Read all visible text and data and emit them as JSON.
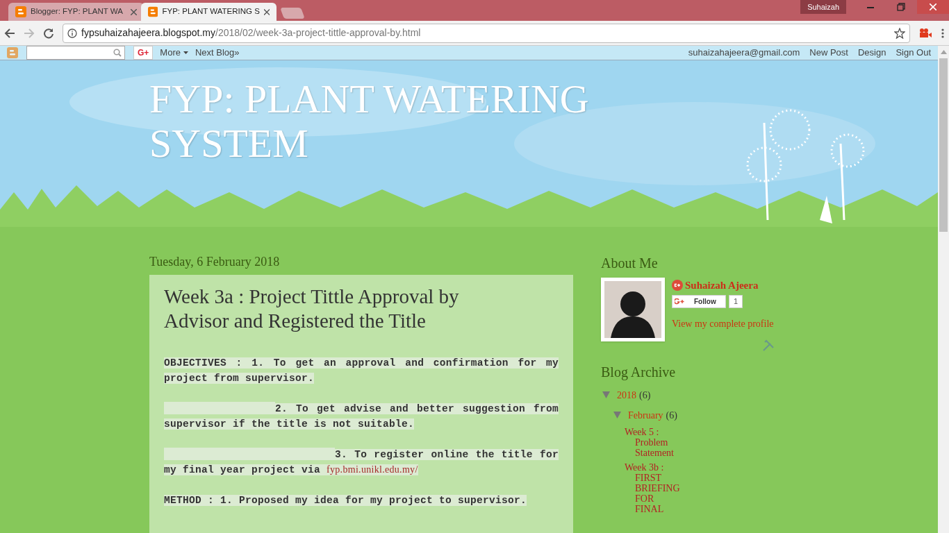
{
  "browser": {
    "tabs": [
      {
        "title": "Blogger: FYP: PLANT WA",
        "selected": false
      },
      {
        "title": "FYP: PLANT WATERING S",
        "selected": true
      }
    ],
    "profile": "Suhaizah",
    "url_host": "fypsuhaizahajeera.blogspot.my",
    "url_path": "/2018/02/week-3a-project-tittle-approval-by.html"
  },
  "navbar": {
    "left_links": [
      "More",
      "Next Blog»"
    ],
    "g_plus": "G+",
    "right_links": [
      "suhaizahajeera@gmail.com",
      "New Post",
      "Design",
      "Sign Out"
    ]
  },
  "blog_title": "FYP: PLANT WATERING SYSTEM",
  "post": {
    "date": "Tuesday, 6 February 2018",
    "title": "Week 3a : Project Tittle Approval by Advisor and Registered the Title",
    "paragraphs": [
      {
        "kind": "first",
        "text": "OBJECTIVES : 1. To get an approval and confirmation for my project from supervisor."
      },
      {
        "kind": "indented",
        "text": "2. To get advise and better suggestion from supervisor if the title is not suitable."
      },
      {
        "kind": "indented-more",
        "text": "3. To register online the title for my final year project via",
        "link": "fyp.bmi.unikl.edu.my/"
      },
      {
        "kind": "first",
        "text": "METHOD : 1. Proposed my idea for my project to supervisor."
      }
    ]
  },
  "about": {
    "heading": "About Me",
    "name": "Suhaizah Ajeera",
    "follow": "Follow",
    "follow_count": "1",
    "profile_link": "View my complete profile"
  },
  "archive": {
    "heading": "Blog Archive",
    "years": [
      {
        "label": "2018",
        "count": "(6)",
        "expanded": true,
        "months": [
          {
            "label": "February",
            "count": "(6)",
            "expanded": true,
            "posts": [
              "Week 5 : Problem Statement",
              "Week 3b : FIRST BRIEFING FOR FINAL"
            ]
          }
        ]
      }
    ]
  }
}
